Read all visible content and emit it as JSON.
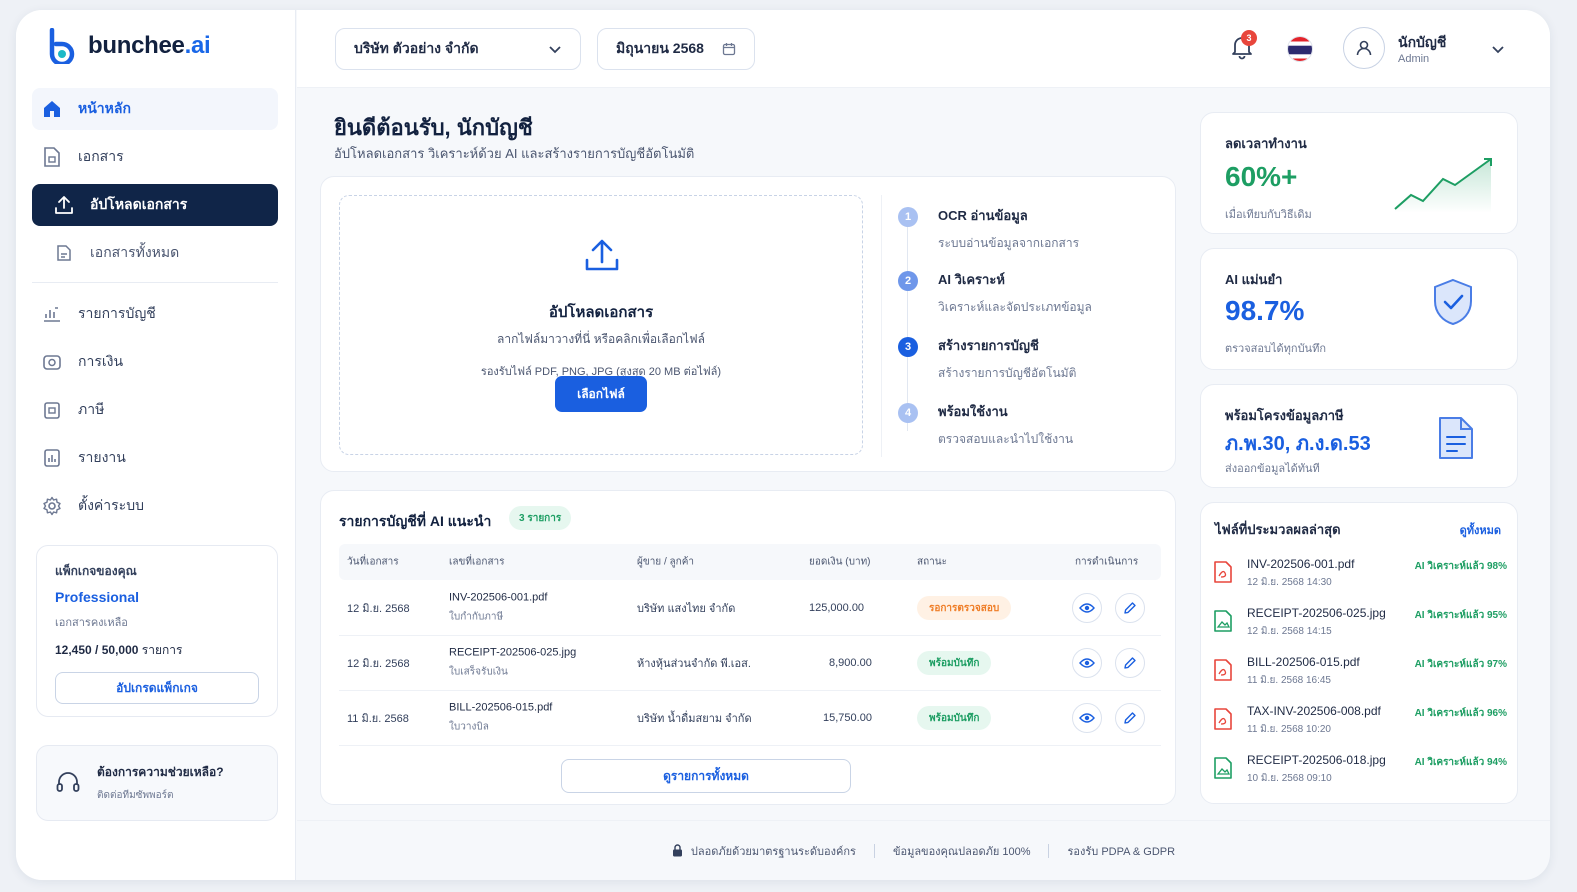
{
  "brand": {
    "name_main": "bunchee",
    "name_ai": ".ai"
  },
  "colors": {
    "primary": "#1a5fe0",
    "navy": "#102548",
    "green": "#1d9e63",
    "orange": "#ef7d26",
    "red": "#e8463c"
  },
  "sidebar": {
    "items": [
      {
        "label": "หน้าหลัก",
        "icon": "home-icon"
      },
      {
        "label": "เอกสาร",
        "icon": "document-icon"
      },
      {
        "label": "อัปโหลดเอกสาร",
        "icon": "upload-icon"
      },
      {
        "label": "เอกสารทั้งหมด",
        "icon": "documents-all-icon"
      },
      {
        "label": "รายการบัญชี",
        "icon": "ledger-icon"
      },
      {
        "label": "การเงิน",
        "icon": "wallet-icon"
      },
      {
        "label": "ภาษี",
        "icon": "tax-icon"
      },
      {
        "label": "รายงาน",
        "icon": "report-icon"
      },
      {
        "label": "ตั้งค่าระบบ",
        "icon": "gear-icon"
      }
    ],
    "package": {
      "title": "แพ็กเกจของคุณ",
      "plan": "Professional",
      "remaining_label": "เอกสารคงเหลือ",
      "used": "12,450",
      "total": "/ 50,000",
      "unit": "รายการ",
      "upgrade": "อัปเกรดแพ็กเกจ"
    },
    "help": {
      "title": "ต้องการความช่วยเหลือ?",
      "subtitle": "ติดต่อทีมซัพพอร์ต"
    }
  },
  "topbar": {
    "company": "บริษัท ตัวอย่าง จำกัด",
    "period": "มิถุนายน 2568",
    "notifications": "3",
    "user_name": "นักบัญชี",
    "user_role": "Admin"
  },
  "welcome": {
    "title": "ยินดีต้อนรับ, นักบัญชี",
    "subtitle": "อัปโหลดเอกสาร วิเคราะห์ด้วย AI และสร้างรายการบัญชีอัตโนมัติ"
  },
  "upload": {
    "title": "อัปโหลดเอกสาร",
    "hint": "ลากไฟล์มาวางที่นี่ หรือคลิกเพื่อเลือกไฟล์",
    "types": "รองรับไฟล์ PDF, PNG, JPG (สูงสุด 20 MB ต่อไฟล์)",
    "button": "เลือกไฟล์"
  },
  "steps": [
    {
      "num": "1",
      "title": "OCR อ่านข้อมูล",
      "desc": "ระบบอ่านข้อมูลจากเอกสาร",
      "color": "#a9c1f2"
    },
    {
      "num": "2",
      "title": "AI วิเคราะห์",
      "desc": "วิเคราะห์และจัดประเภทข้อมูล",
      "color": "#6f97ea"
    },
    {
      "num": "3",
      "title": "สร้างรายการบัญชี",
      "desc": "สร้างรายการบัญชีอัตโนมัติ",
      "color": "#1a5fe0"
    },
    {
      "num": "4",
      "title": "พร้อมใช้งาน",
      "desc": "ตรวจสอบและนำไปใช้งาน",
      "color": "#a9c1f2"
    }
  ],
  "table": {
    "title": "รายการบัญชีที่ AI แนะนำ",
    "badge": "3 รายการ",
    "headers": [
      "วันที่เอกสาร",
      "เลขที่เอกสาร",
      "ผู้ขาย / ลูกค้า",
      "ยอดเงิน (บาท)",
      "สถานะ",
      "การดำเนินการ"
    ],
    "rows": [
      {
        "date": "12 มิ.ย. 2568",
        "doc": "INV-202506-001.pdf",
        "type": "ใบกำกับภาษี",
        "party": "บริษัท แสงไทย จำกัด",
        "amount": "125,000.00",
        "status": "รอการตรวจสอบ",
        "status_kind": "pending"
      },
      {
        "date": "12 มิ.ย. 2568",
        "doc": "RECEIPT-202506-025.jpg",
        "type": "ใบเสร็จรับเงิน",
        "party": "ห้างหุ้นส่วนจำกัด พี.เอส.",
        "amount": "8,900.00",
        "status": "พร้อมบันทึก",
        "status_kind": "ready"
      },
      {
        "date": "11 มิ.ย. 2568",
        "doc": "BILL-202506-015.pdf",
        "type": "ใบวางบิล",
        "party": "บริษัท น้ำดื่มสยาม จำกัด",
        "amount": "15,750.00",
        "status": "พร้อมบันทึก",
        "status_kind": "ready"
      }
    ],
    "view_all": "ดูรายการทั้งหมด"
  },
  "stats": [
    {
      "label": "ลดเวลาทำงาน",
      "value": "60%+",
      "note": "เมื่อเทียบกับวิธีเดิม",
      "color": "#1d9e63",
      "icon": "trend-up-icon"
    },
    {
      "label": "AI แม่นยำ",
      "value": "98.7%",
      "note": "ตรวจสอบได้ทุกบันทึก",
      "color": "#1a5fe0",
      "icon": "shield-check-icon"
    },
    {
      "label": "พร้อมโครงข้อมูลภาษี",
      "value": "ภ.พ.30, ภ.ง.ด.53",
      "note": "ส่งออกข้อมูลได้ทันที",
      "color": "#1a5fe0",
      "icon": "tax-document-icon"
    }
  ],
  "recent": {
    "title": "ไฟล์ที่ประมวลผลล่าสุด",
    "view_all": "ดูทั้งหมด",
    "files": [
      {
        "name": "INV-202506-001.pdf",
        "date": "12 มิ.ย. 2568 14:30",
        "status": "AI วิเคราะห์แล้ว 98%",
        "kind": "pdf"
      },
      {
        "name": "RECEIPT-202506-025.jpg",
        "date": "12 มิ.ย. 2568 14:15",
        "status": "AI วิเคราะห์แล้ว 95%",
        "kind": "img"
      },
      {
        "name": "BILL-202506-015.pdf",
        "date": "11 มิ.ย. 2568 16:45",
        "status": "AI วิเคราะห์แล้ว 97%",
        "kind": "pdf"
      },
      {
        "name": "TAX-INV-202506-008.pdf",
        "date": "11 มิ.ย. 2568 10:20",
        "status": "AI วิเคราะห์แล้ว 96%",
        "kind": "pdf"
      },
      {
        "name": "RECEIPT-202506-018.jpg",
        "date": "10 มิ.ย. 2568 09:10",
        "status": "AI วิเคราะห์แล้ว 94%",
        "kind": "img"
      }
    ]
  },
  "footer": [
    "ปลอดภัยด้วยมาตรฐานระดับองค์กร",
    "ข้อมูลของคุณปลอดภัย 100%",
    "รองรับ PDPA & GDPR"
  ]
}
